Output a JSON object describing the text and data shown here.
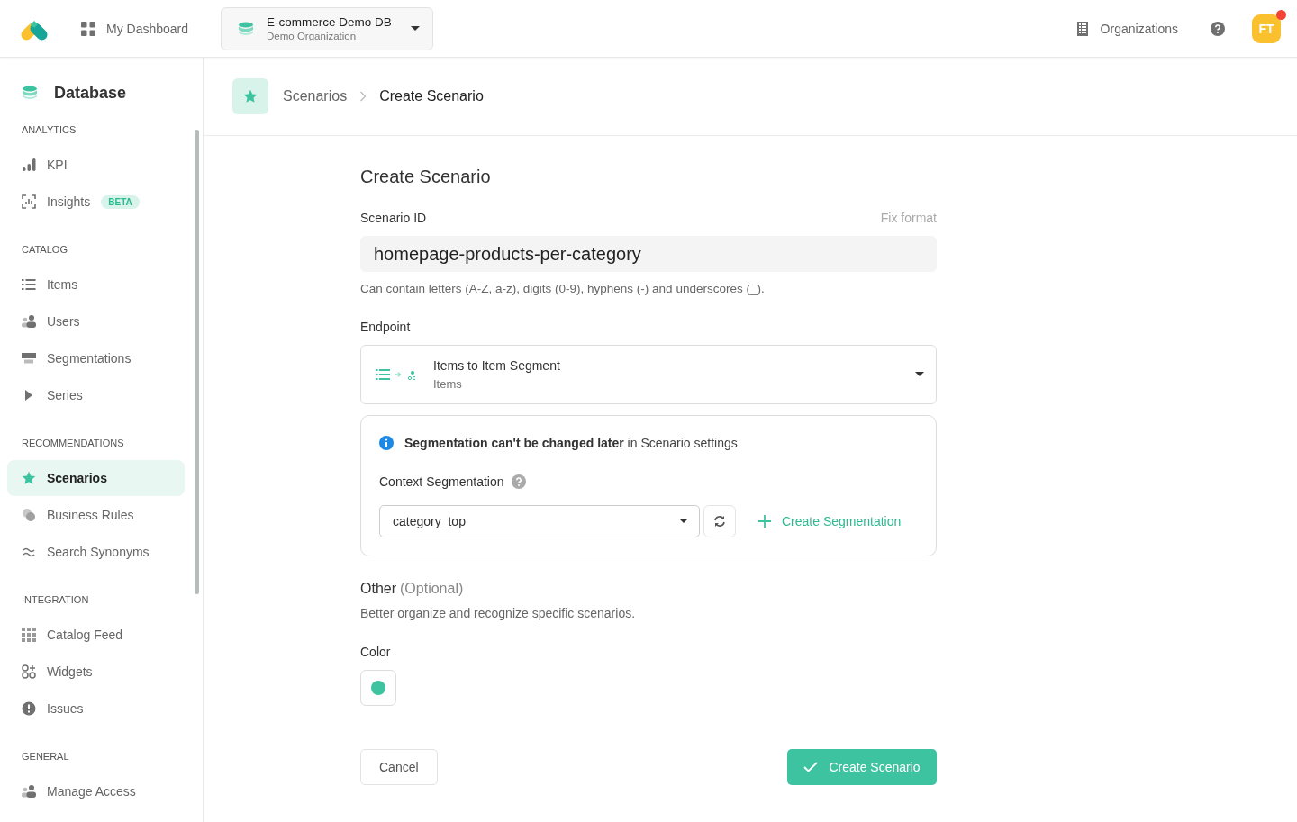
{
  "topbar": {
    "dashboard_link": "My Dashboard",
    "database_selector": {
      "name": "E-commerce Demo DB",
      "organization": "Demo Organization"
    },
    "organizations_link": "Organizations",
    "avatar": {
      "initials": "FT",
      "notification": true
    }
  },
  "sidebar": {
    "title": "Database",
    "sections": [
      {
        "label": "ANALYTICS",
        "items": [
          {
            "label": "KPI",
            "selected": false
          },
          {
            "label": "Insights",
            "badge": "BETA",
            "selected": false
          }
        ]
      },
      {
        "label": "CATALOG",
        "items": [
          {
            "label": "Items",
            "selected": false
          },
          {
            "label": "Users",
            "selected": false
          },
          {
            "label": "Segmentations",
            "selected": false
          },
          {
            "label": "Series",
            "selected": false
          }
        ]
      },
      {
        "label": "RECOMMENDATIONS",
        "items": [
          {
            "label": "Scenarios",
            "selected": true
          },
          {
            "label": "Business Rules",
            "selected": false
          },
          {
            "label": "Search Synonyms",
            "selected": false
          }
        ]
      },
      {
        "label": "INTEGRATION",
        "items": [
          {
            "label": "Catalog Feed",
            "selected": false
          },
          {
            "label": "Widgets",
            "selected": false
          },
          {
            "label": "Issues",
            "selected": false
          }
        ]
      },
      {
        "label": "GENERAL",
        "items": [
          {
            "label": "Manage Access",
            "selected": false
          }
        ]
      }
    ]
  },
  "breadcrumb": [
    {
      "label": "Scenarios"
    },
    {
      "label": "Create Scenario"
    }
  ],
  "form": {
    "title": "Create Scenario",
    "scenario_id": {
      "label": "Scenario ID",
      "action": "Fix format",
      "value": "homepage-products-per-category",
      "hint": "Can contain letters (A-Z, a-z), digits (0-9), hyphens (-) and underscores (_)."
    },
    "endpoint": {
      "label": "Endpoint",
      "name": "Items to Item Segment",
      "subtitle": "Items"
    },
    "segmentation": {
      "notice": "**Segmentation can't be changed later** in Scenario settings",
      "label": "Context Segmentation",
      "value": "category_top",
      "create_link": "Create Segmentation"
    },
    "other": {
      "title": "Other",
      "optional": "(Optional)",
      "description": "Better organize and recognize specific scenarios."
    },
    "color": {
      "label": "Color",
      "color": "#3dc3a0"
    },
    "buttons": {
      "cancel": "Cancel",
      "submit": "Create Scenario"
    }
  }
}
